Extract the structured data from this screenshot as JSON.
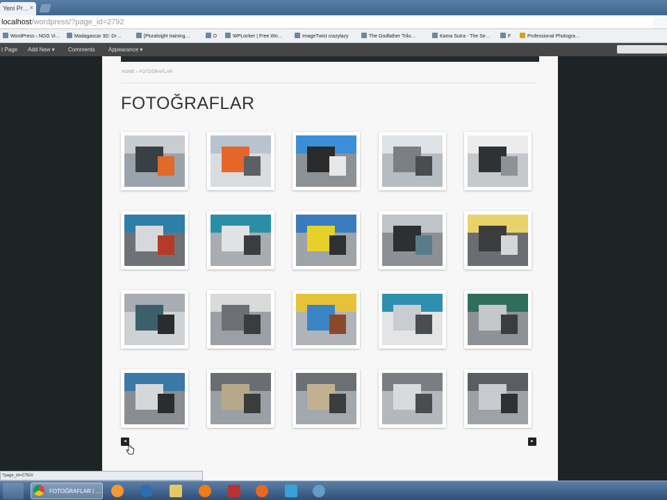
{
  "browser": {
    "tab_title": "Yeni Pr…",
    "tab_close": "×",
    "url_host": "localhost",
    "url_path": "/wordpress/?page_id=2792",
    "bookmarks": [
      "WordPress › NGG Vi…",
      "Madagascar 3D: Dr…",
      "[Pluralsight training…",
      "D",
      "WPLocker | Free Wo…",
      "ImageTwist crazylazy",
      "The Godfather Trilo…",
      "Kama Sutra - The Se…",
      "F",
      "Professional Photogra…"
    ]
  },
  "admin_bar": {
    "items": [
      "t Page",
      "Add New ▾",
      "Comments",
      "Appearance ▾"
    ]
  },
  "page": {
    "breadcrumb": "HOME › FOTOĞRAFLAR",
    "title": "FOTOĞRAFLAR",
    "pager_prev": "◂",
    "pager_next": "▸"
  },
  "gallery": {
    "rows": 4,
    "cols": 5,
    "items": [
      "thumb-image",
      "thumb-image",
      "thumb-image",
      "thumb-image",
      "thumb-image",
      "thumb-image",
      "thumb-image",
      "thumb-image",
      "thumb-image",
      "thumb-image",
      "thumb-image",
      "thumb-image",
      "thumb-image",
      "thumb-image",
      "thumb-image",
      "thumb-image",
      "thumb-image",
      "thumb-image",
      "thumb-image",
      "thumb-image"
    ]
  },
  "status": {
    "link": "?page_id=2792#"
  },
  "taskbar": {
    "active_window": "FOTOĞRAFLAR | …"
  },
  "colors": {
    "page_bg": "#1c2426",
    "content_bg": "#f7f7f7",
    "title_color": "#333333"
  }
}
